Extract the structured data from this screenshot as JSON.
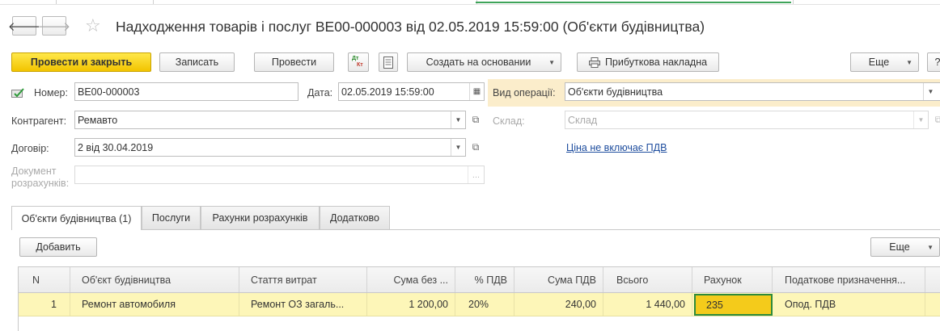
{
  "window": {
    "title": "Надходження товарів і послуг ВЕ00-000003 від 02.05.2019 15:59:00 (Об'єкти будівництва)",
    "back_glyph": "🡐",
    "forward_glyph": "🡒",
    "star_glyph": "☆"
  },
  "toolbar": {
    "post_and_close": "Провести и закрыть",
    "write": "Записать",
    "post": "Провести",
    "create_based_on": "Создать на основании",
    "receipt_invoice": "Прибуткова накладна",
    "more": "Еще",
    "help": "?",
    "dtkt_icon_text_top": "Дт",
    "dtkt_icon_text_bottom": "Кт"
  },
  "form": {
    "number_label": "Номер:",
    "number_value": "ВЕ00-000003",
    "date_label": "Дата:",
    "date_value": "02.05.2019 15:59:00",
    "operation_label": "Вид операції:",
    "operation_value": "Об'єкти будівництва",
    "counterparty_label": "Контрагент:",
    "counterparty_value": "Ремавто",
    "warehouse_label": "Склад:",
    "warehouse_value": "Склад",
    "contract_label": "Договір:",
    "contract_value": "2 від 30.04.2019",
    "price_link": "Ціна не включає ПДВ",
    "settlement_doc_label_1": "Документ",
    "settlement_doc_label_2": "розрахунків:",
    "settlement_doc_value": "",
    "ellipsis": "..."
  },
  "tabs": [
    {
      "label": "Об'єкти будівництва (1)",
      "active": true
    },
    {
      "label": "Послуги",
      "active": false
    },
    {
      "label": "Рахунки розрахунків",
      "active": false
    },
    {
      "label": "Додатково",
      "active": false
    }
  ],
  "table_toolbar": {
    "add": "Добавить",
    "more": "Еще"
  },
  "table": {
    "columns": [
      "N",
      "Об'єкт будівництва",
      "Стаття витрат",
      "Сума без ...",
      "% ПДВ",
      "Сума ПДВ",
      "Всього",
      "Рахунок",
      "Податкове призначення..."
    ],
    "rows": [
      [
        "1",
        "Ремонт автомобиля",
        "Ремонт ОЗ загаль...",
        "1 200,00",
        "20%",
        "240,00",
        "1 440,00",
        "235",
        "Опод. ПДВ"
      ]
    ]
  },
  "colors": {
    "primary_button": "#f2c400",
    "selected_row": "#fdf6b8",
    "selected_cell": "#f4cb1b",
    "selected_cell_border": "#2e8b3a",
    "operation_highlight": "#fbedcb",
    "link": "#1e4d9e"
  }
}
